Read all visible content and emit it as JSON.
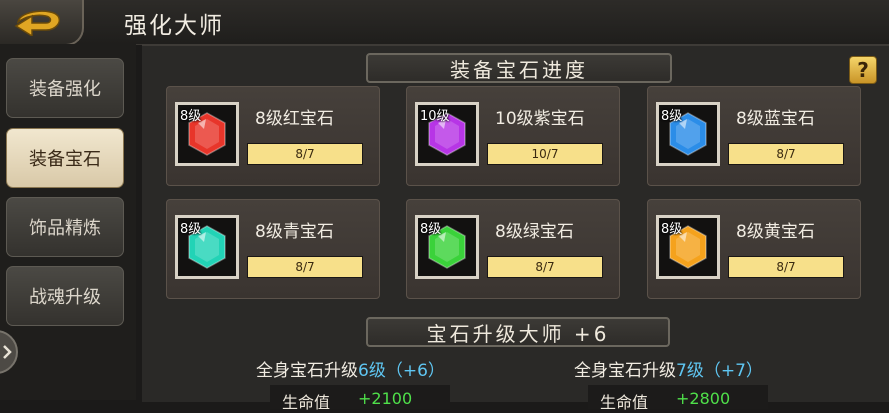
{
  "header": {
    "title": "强化大师",
    "back_icon": "return-arrow-icon"
  },
  "sidebar": {
    "tabs": [
      {
        "label": "装备强化",
        "active": false
      },
      {
        "label": "装备宝石",
        "active": true
      },
      {
        "label": "饰品精炼",
        "active": false
      },
      {
        "label": "战魂升级",
        "active": false
      }
    ]
  },
  "gem_section": {
    "title": "装备宝石进度",
    "help_label": "?",
    "gems": [
      {
        "level": "8级",
        "name": "8级红宝石",
        "progress": "8/7",
        "fill_fraction": 1.0,
        "color": "#e8352a",
        "icon": "red-gem-icon"
      },
      {
        "level": "10级",
        "name": "10级紫宝石",
        "progress": "10/7",
        "fill_fraction": 1.0,
        "color": "#b735e6",
        "icon": "purple-gem-icon"
      },
      {
        "level": "8级",
        "name": "8级蓝宝石",
        "progress": "8/7",
        "fill_fraction": 1.0,
        "color": "#2b8de8",
        "icon": "blue-gem-icon"
      },
      {
        "level": "8级",
        "name": "8级青宝石",
        "progress": "8/7",
        "fill_fraction": 1.0,
        "color": "#22d3b6",
        "icon": "cyan-gem-icon"
      },
      {
        "level": "8级",
        "name": "8级绿宝石",
        "progress": "8/7",
        "fill_fraction": 1.0,
        "color": "#3ad23a",
        "icon": "green-gem-icon"
      },
      {
        "level": "8级",
        "name": "8级黄宝石",
        "progress": "8/7",
        "fill_fraction": 1.0,
        "color": "#f5a21c",
        "icon": "yellow-gem-icon"
      }
    ]
  },
  "master_section": {
    "title": "宝石升级大师 +6",
    "current": {
      "prefix": "全身宝石升级",
      "level": "6级",
      "bonus": "（+6）",
      "attr_name": "生命值",
      "attr_value": "+2100"
    },
    "next": {
      "prefix": "全身宝石升级",
      "level": "7级",
      "bonus": "（+7）",
      "attr_name": "生命值",
      "attr_value": "+2800"
    }
  },
  "colors": {
    "accent_gold": "#f7e08a",
    "highlight_blue": "#5fc6f2",
    "value_green": "#4fe04a"
  }
}
